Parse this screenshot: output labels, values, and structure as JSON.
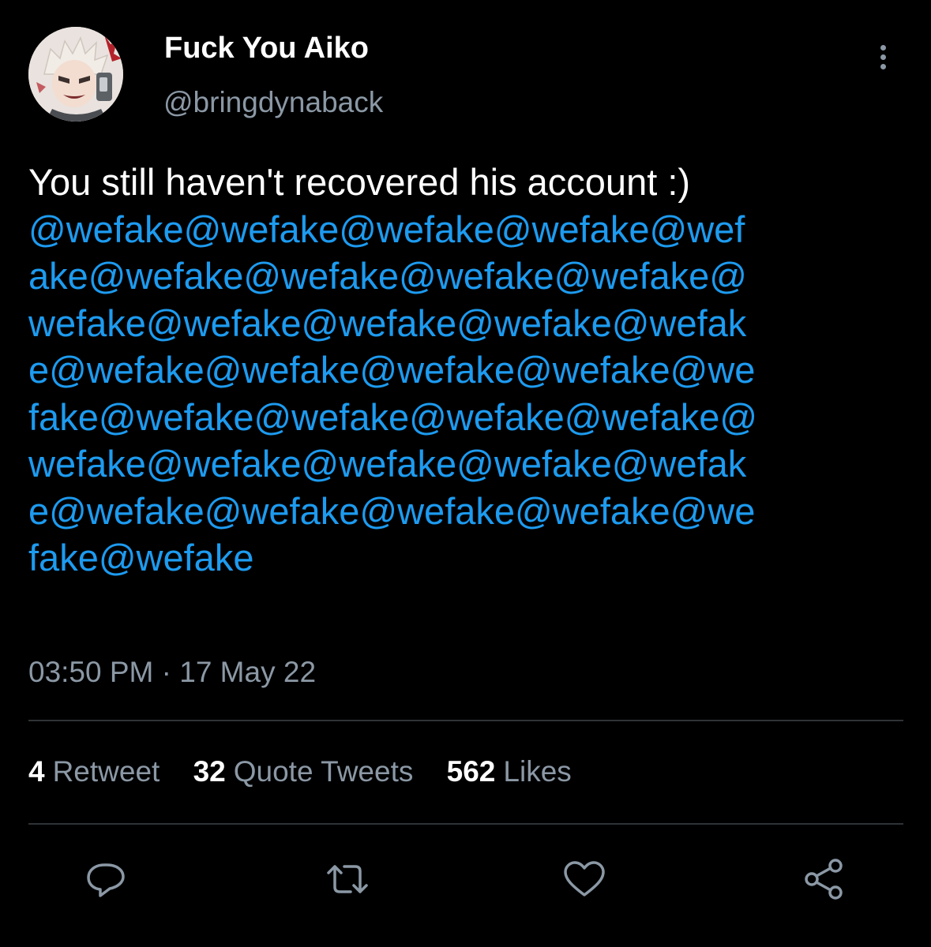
{
  "author": {
    "display_name": "Fuck You Aiko",
    "handle": "@bringdynaback",
    "avatar": "anime-character-avatar"
  },
  "tweet": {
    "text_lines": [
      "You still haven't recovered his account :)",
      "@wefake@wefake@wefake@wefake@wef",
      "ake@wefake@wefake@wefake@wefake@",
      "wefake@wefake@wefake@wefake@wefak",
      "e@wefake@wefake@wefake@wefake@we",
      "fake@wefake@wefake@wefake@wefake@",
      "wefake@wefake@wefake@wefake@wefak",
      "e@wefake@wefake@wefake@wefake@we",
      "fake@wefake"
    ],
    "timestamp": "03:50 PM · 17 May 22"
  },
  "stats": {
    "retweets": {
      "count": "4",
      "label": "Retweet"
    },
    "quotes": {
      "count": "32",
      "label": "Quote Tweets"
    },
    "likes": {
      "count": "562",
      "label": "Likes"
    }
  },
  "actions": {
    "reply": "reply-icon",
    "retweet": "retweet-icon",
    "like": "heart-icon",
    "share": "share-icon",
    "more": "more-vertical-icon"
  },
  "colors": {
    "background": "#000000",
    "text": "#ffffff",
    "secondary": "#8b98a5",
    "mention": "#1d9bf0",
    "divider": "#2f3336"
  }
}
